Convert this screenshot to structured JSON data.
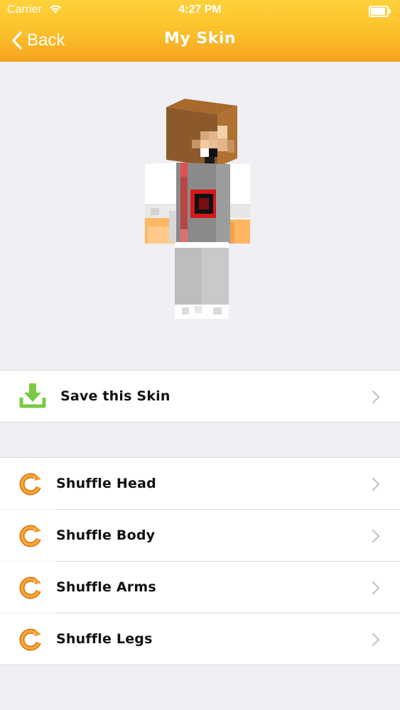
{
  "status": {
    "carrier": "Carrier",
    "time": "4:27 PM"
  },
  "nav": {
    "back_label": "Back",
    "title": "My Skin"
  },
  "actions": {
    "save_label": "Save this Skin",
    "shuffle_head_label": "Shuffle Head",
    "shuffle_body_label": "Shuffle Body",
    "shuffle_arms_label": "Shuffle Arms",
    "shuffle_legs_label": "Shuffle Legs"
  },
  "colors": {
    "nav_gradient_top": "#ffd23a",
    "nav_gradient_bottom": "#f6a321",
    "save_icon_green": "#7ac943",
    "shuffle_icon_orange": "#f39a2a"
  },
  "icons": {
    "save": "download-icon",
    "shuffle": "refresh-icon",
    "chevron": "chevron-right-icon"
  }
}
